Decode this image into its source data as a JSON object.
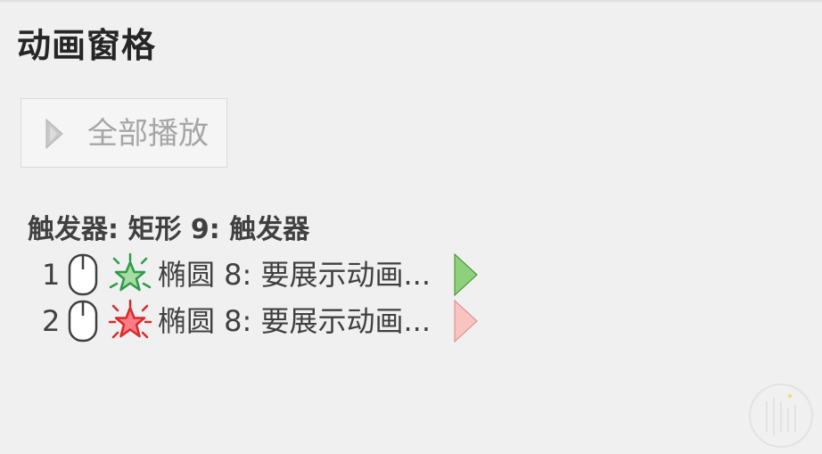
{
  "pane": {
    "title": "动画窗格"
  },
  "toolbar": {
    "play_all_label": "全部播放",
    "play_icon": "play-triangle-icon"
  },
  "trigger": {
    "header": "触发器: 矩形 9: 触发器"
  },
  "animations": [
    {
      "number": "1",
      "start_icon": "mouse-click-icon",
      "effect_icon": "entrance-star-icon",
      "target": "椭圆 8: 要展示动画...",
      "timeline_icon": "timeline-bar-icon",
      "colors": {
        "effect": "#2e9b4a",
        "effect_fill": "#a8dca0",
        "timeline": "#8fd17a"
      }
    },
    {
      "number": "2",
      "start_icon": "mouse-click-icon",
      "effect_icon": "emphasis-star-icon",
      "target": "椭圆 8: 要展示动画...",
      "timeline_icon": "timeline-bar-icon",
      "colors": {
        "effect": "#d92b2b",
        "effect_fill": "#ff7b86",
        "timeline": "#f8c4c0"
      }
    }
  ],
  "colors": {
    "background": "#f0f0f0",
    "text": "#404040",
    "disabled_text": "#a6a6a6"
  }
}
